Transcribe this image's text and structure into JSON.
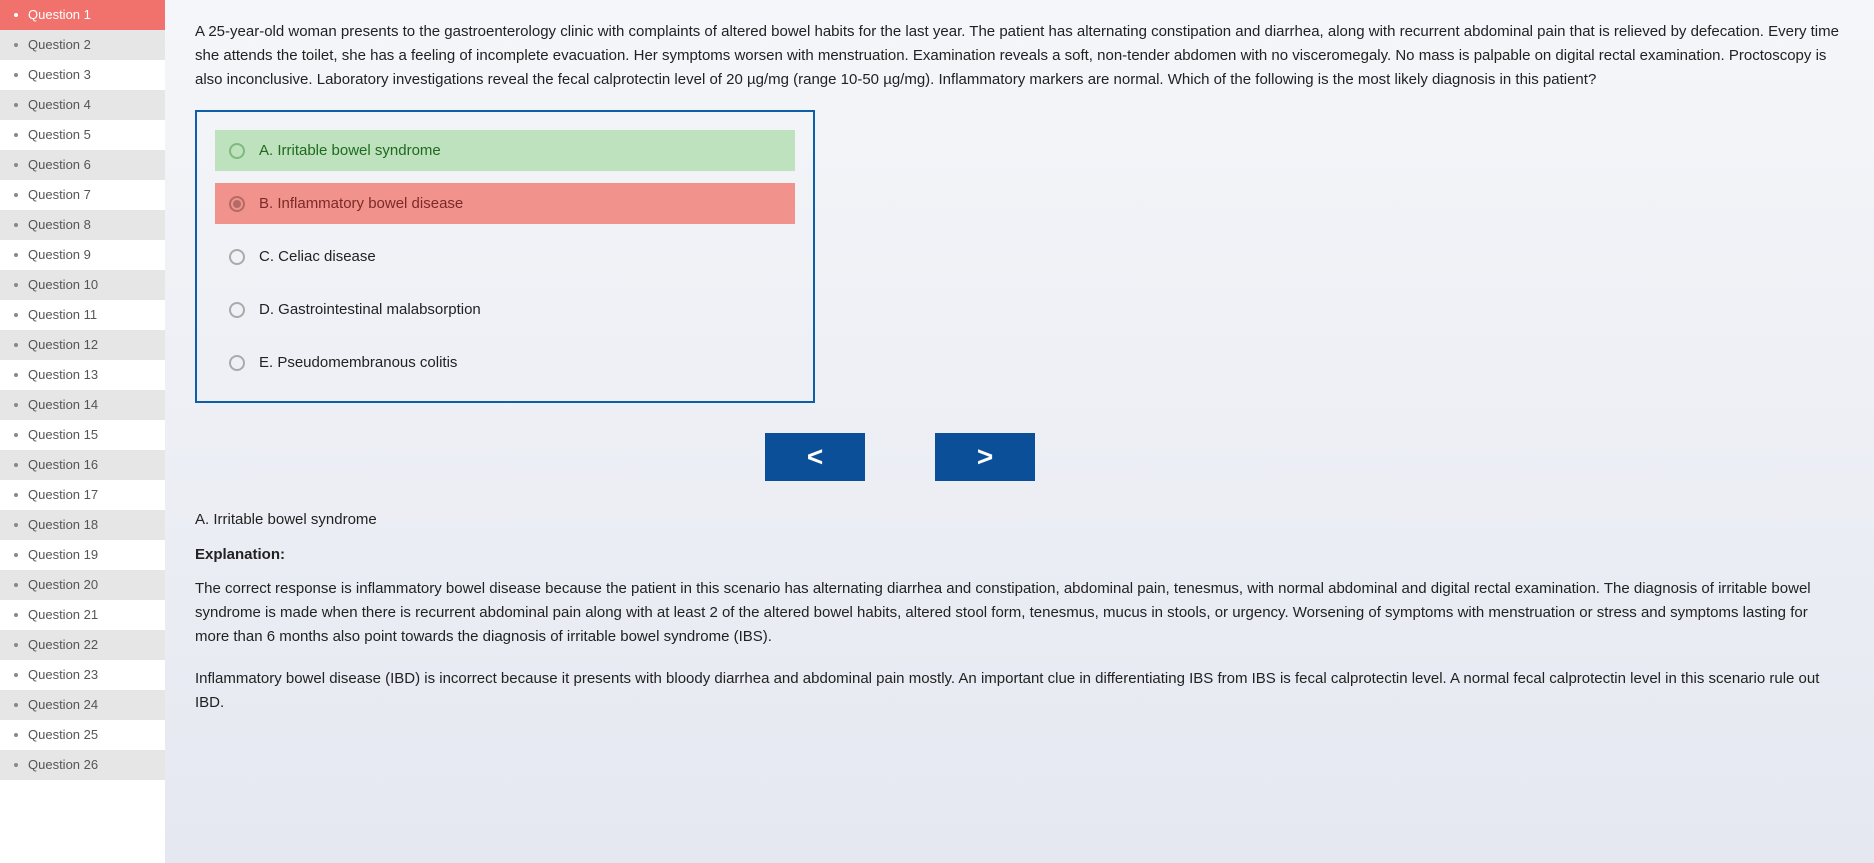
{
  "sidebar": {
    "active_index": 0,
    "items": [
      {
        "label": "Question 1"
      },
      {
        "label": "Question 2"
      },
      {
        "label": "Question 3"
      },
      {
        "label": "Question 4"
      },
      {
        "label": "Question 5"
      },
      {
        "label": "Question 6"
      },
      {
        "label": "Question 7"
      },
      {
        "label": "Question 8"
      },
      {
        "label": "Question 9"
      },
      {
        "label": "Question 10"
      },
      {
        "label": "Question 11"
      },
      {
        "label": "Question 12"
      },
      {
        "label": "Question 13"
      },
      {
        "label": "Question 14"
      },
      {
        "label": "Question 15"
      },
      {
        "label": "Question 16"
      },
      {
        "label": "Question 17"
      },
      {
        "label": "Question 18"
      },
      {
        "label": "Question 19"
      },
      {
        "label": "Question 20"
      },
      {
        "label": "Question 21"
      },
      {
        "label": "Question 22"
      },
      {
        "label": "Question 23"
      },
      {
        "label": "Question 24"
      },
      {
        "label": "Question 25"
      },
      {
        "label": "Question 26"
      }
    ]
  },
  "question": {
    "stem": "A 25-year-old woman presents to the gastroenterology clinic with complaints of altered bowel habits for the last year. The patient has alternating constipation and diarrhea, along with recurrent abdominal pain that is relieved by defecation. Every time she attends the toilet, she has a feeling of incomplete evacuation. Her symptoms worsen with menstruation. Examination reveals a soft, non-tender abdomen with no visceromegaly. No mass is palpable on digital rectal examination. Proctoscopy is also inconclusive. Laboratory investigations reveal the fecal calprotectin level of 20 µg/mg (range 10-50 µg/mg). Inflammatory markers are normal. Which of the following is the most likely diagnosis in this patient?",
    "options": [
      {
        "text": "A. Irritable bowel syndrome",
        "state": "correct"
      },
      {
        "text": "B. Inflammatory bowel disease",
        "state": "wrong"
      },
      {
        "text": "C. Celiac disease",
        "state": "none"
      },
      {
        "text": "D. Gastrointestinal malabsorption",
        "state": "none"
      },
      {
        "text": "E. Pseudomembranous colitis",
        "state": "none"
      }
    ]
  },
  "nav": {
    "prev_glyph": "<",
    "next_glyph": ">"
  },
  "answer": {
    "heading": "A. Irritable bowel syndrome",
    "label": "Explanation:",
    "paragraphs": [
      "The correct response is inflammatory bowel disease because the patient in this scenario has alternating diarrhea and constipation, abdominal pain, tenesmus, with normal abdominal and digital rectal examination. The diagnosis of irritable bowel syndrome is made when there is recurrent abdominal pain along with at least 2 of the altered bowel habits, altered stool form, tenesmus, mucus in stools, or urgency. Worsening of symptoms with menstruation or stress and symptoms lasting for more than 6 months also point towards the diagnosis of irritable bowel syndrome (IBS).",
      "Inflammatory bowel disease (IBD) is incorrect because it presents with bloody diarrhea and abdominal pain mostly. An important clue in differentiating IBS from IBS is fecal calprotectin level. A normal fecal calprotectin level in this scenario rule out IBD."
    ]
  }
}
